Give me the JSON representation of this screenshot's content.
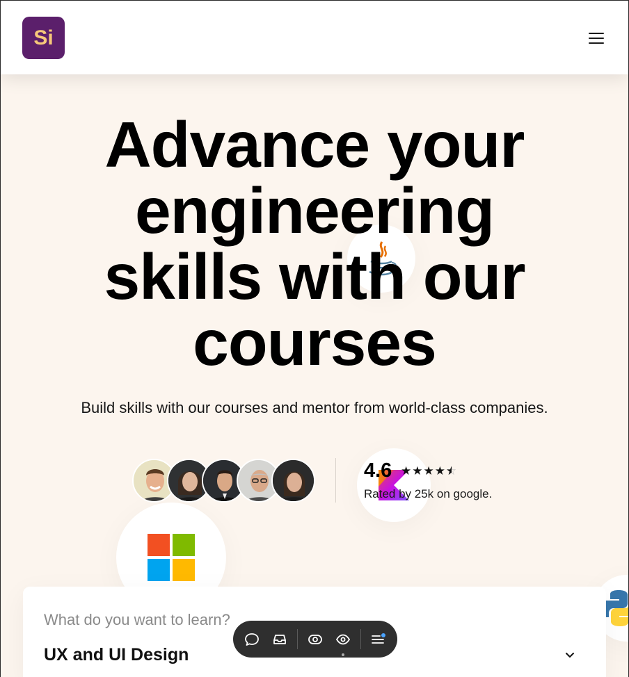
{
  "colors": {
    "logo_bg": "#5b1f6b",
    "logo_text": "#f7c97a",
    "hero_bg": "#fcf5ee",
    "toolbar_bg": "#2f2f2f",
    "notify_dot": "#4aa3ff"
  },
  "header": {
    "logo_text": "Si",
    "menu_icon": "hamburger-menu-icon"
  },
  "hero": {
    "title_lines": [
      "Advance your",
      "engineering",
      "skills with our",
      "courses"
    ],
    "subtitle": "Build skills with our courses and mentor from world-class companies."
  },
  "social_proof": {
    "avatars": [
      "mentor-avatar-1",
      "mentor-avatar-2",
      "mentor-avatar-3",
      "mentor-avatar-4",
      "mentor-avatar-5"
    ],
    "rating": "4.6",
    "rating_stars": 4.5,
    "rated_by": "Rated by 25k on google."
  },
  "floating_logos": [
    "java-logo",
    "kotlin-logo",
    "microsoft-logo",
    "python-logo"
  ],
  "search": {
    "label": "What do you want to learn?",
    "selected": "UX and UI Design"
  },
  "toolbar": {
    "buttons": [
      "comment-icon",
      "inbox-icon",
      "preview-icon",
      "eye-icon",
      "menu-list-icon"
    ]
  }
}
